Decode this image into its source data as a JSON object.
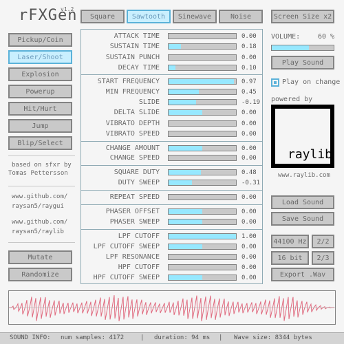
{
  "app": {
    "title": "rFXGen",
    "version": "v1.2"
  },
  "wave_tabs": [
    "Square",
    "Sawtooth",
    "Sinewave",
    "Noise"
  ],
  "active_wave_tab": "Sawtooth",
  "screen_size_button": "Screen Size x2",
  "left_buttons": [
    "Pickup/Coin",
    "Laser/Shoot",
    "Explosion",
    "Powerup",
    "Hit/Hurt",
    "Jump",
    "Blip/Select"
  ],
  "active_left_button": "Laser/Shoot",
  "credits": {
    "line1": "based on sfxr by",
    "line2": "Tomas Pettersson"
  },
  "links": [
    {
      "line1": "www.github.com/",
      "line2": "raysan5/raygui"
    },
    {
      "line1": "www.github.com/",
      "line2": "raysan5/raylib"
    }
  ],
  "mutate_button": "Mutate",
  "randomize_button": "Randomize",
  "params": [
    {
      "label": "ATTACK TIME",
      "value": "0.00",
      "level": 0.0
    },
    {
      "label": "SUSTAIN TIME",
      "value": "0.18",
      "level": 0.18
    },
    {
      "label": "SUSTAIN PUNCH",
      "value": "0.00",
      "level": 0.0
    },
    {
      "label": "DECAY TIME",
      "value": "0.10",
      "level": 0.1
    },
    {
      "label": "START FREQUENCY",
      "value": "0.97",
      "level": 0.97
    },
    {
      "label": "MIN FREQUENCY",
      "value": "0.45",
      "level": 0.45
    },
    {
      "label": "SLIDE",
      "value": "-0.19",
      "level": 0.405
    },
    {
      "label": "DELTA SLIDE",
      "value": "0.00",
      "level": 0.5
    },
    {
      "label": "VIBRATO DEPTH",
      "value": "0.00",
      "level": 0.0
    },
    {
      "label": "VIBRATO SPEED",
      "value": "0.00",
      "level": 0.0
    },
    {
      "label": "CHANGE AMOUNT",
      "value": "0.00",
      "level": 0.5
    },
    {
      "label": "CHANGE SPEED",
      "value": "0.00",
      "level": 0.0
    },
    {
      "label": "SQUARE DUTY",
      "value": "0.48",
      "level": 0.48
    },
    {
      "label": "DUTY SWEEP",
      "value": "-0.31",
      "level": 0.345
    },
    {
      "label": "REPEAT SPEED",
      "value": "0.00",
      "level": 0.0
    },
    {
      "label": "PHASER OFFSET",
      "value": "0.00",
      "level": 0.5
    },
    {
      "label": "PHASER SWEEP",
      "value": "0.00",
      "level": 0.5
    },
    {
      "label": "LPF CUTOFF",
      "value": "1.00",
      "level": 1.0
    },
    {
      "label": "LPF CUTOFF SWEEP",
      "value": "0.00",
      "level": 0.5
    },
    {
      "label": "LPF RESONANCE",
      "value": "0.00",
      "level": 0.0
    },
    {
      "label": "HPF CUTOFF",
      "value": "0.00",
      "level": 0.0
    },
    {
      "label": "HPF CUTOFF SWEEP",
      "value": "0.00",
      "level": 0.5
    }
  ],
  "volume": {
    "label": "VOLUME:",
    "value": "60 %",
    "level": 0.6
  },
  "play_sound_button": "Play Sound",
  "play_on_change": {
    "label": "Play on change",
    "checked": true
  },
  "powered_by": "powered by",
  "raylib_logo": "raylib",
  "raylib_url": "www.raylib.com",
  "load_sound_button": "Load Sound",
  "save_sound_button": "Save Sound",
  "sample_rate_button": "44100 Hz",
  "sample_rate_page": "2/2",
  "bit_depth_button": "16 bit",
  "bit_depth_page": "2/3",
  "export_button": "Export .Wav",
  "status": {
    "sound_info": "SOUND INFO:",
    "num_samples": "num samples: 4172",
    "duration": "duration: 94 ms",
    "wave_size": "Wave size: 8344 bytes",
    "divider": "|"
  },
  "colors": {
    "accent_fill": "#97e8ff",
    "active_border": "#5bb2d9",
    "waveform": "#e06c80",
    "panel_border": "#90abb5"
  }
}
